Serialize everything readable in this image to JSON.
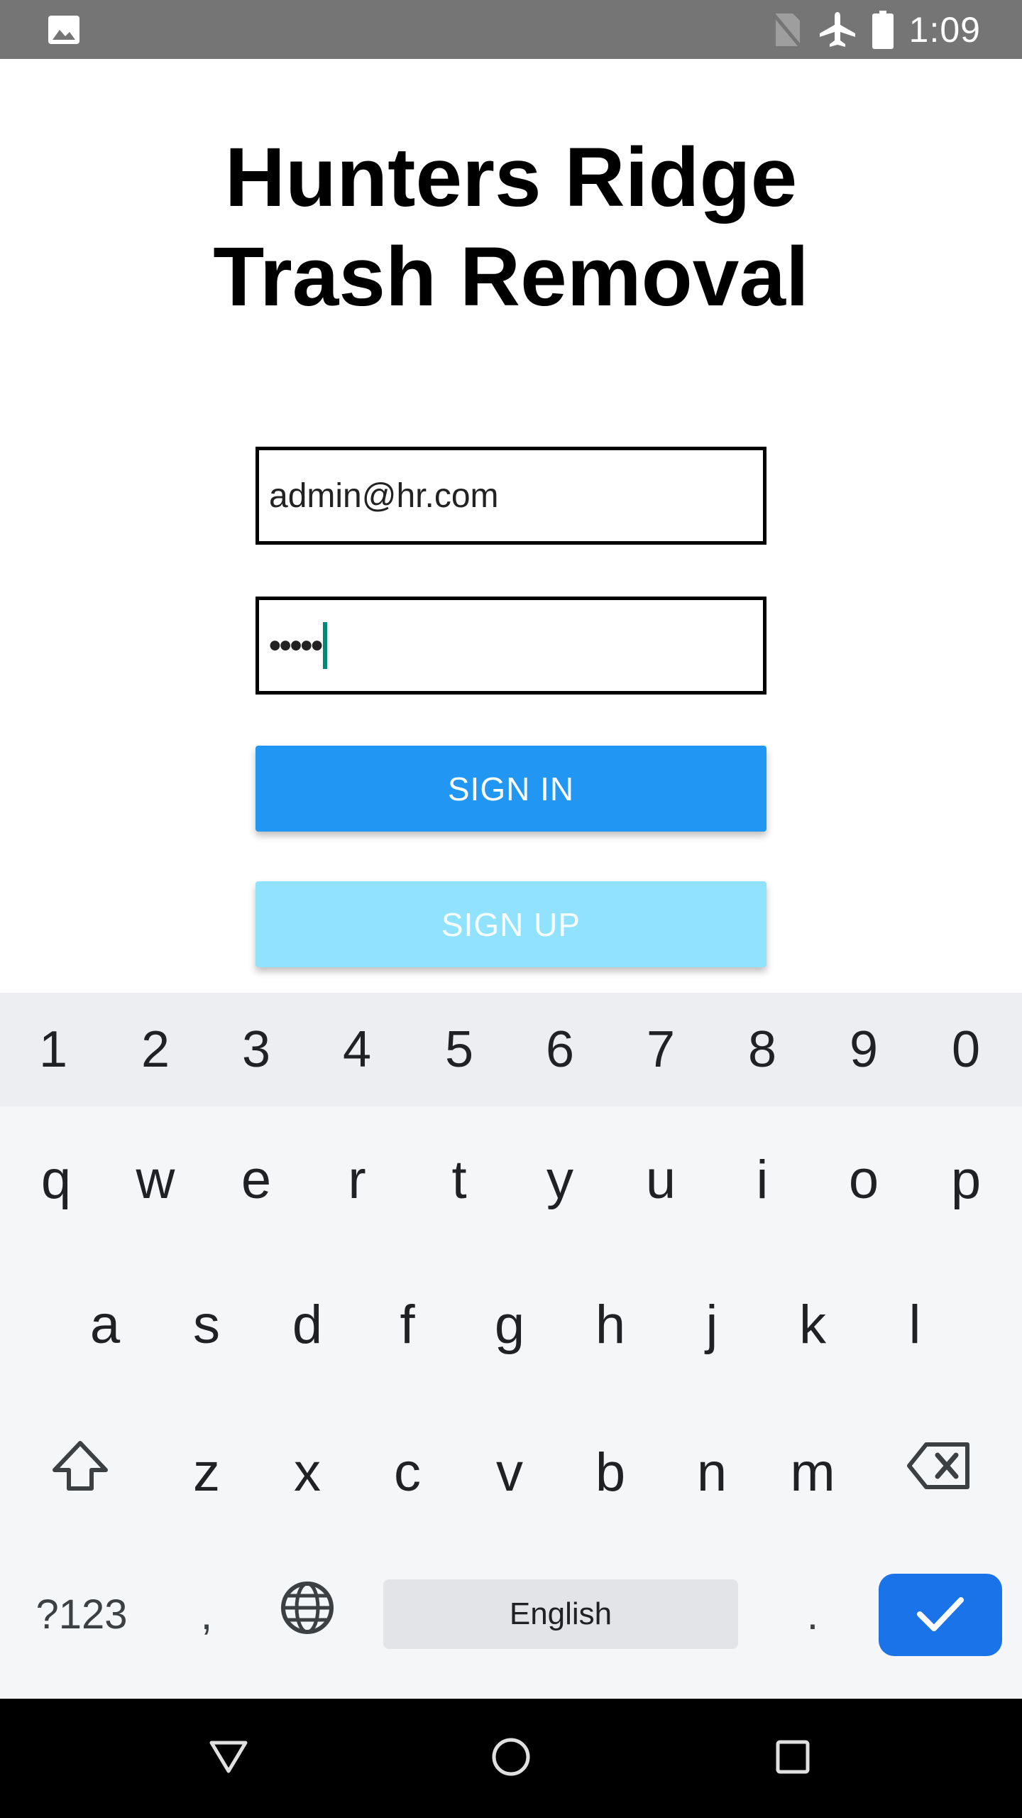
{
  "status_bar": {
    "time": "1:09",
    "icons": [
      "image-icon",
      "no-sim-icon",
      "airplane-mode-icon",
      "battery-icon"
    ]
  },
  "app": {
    "title_line1": "Hunters Ridge",
    "title_line2": "Trash Removal",
    "email_value": "admin@hr.com",
    "password_masked": "•••••",
    "signin_label": "SIGN IN",
    "signup_label": "SIGN UP",
    "colors": {
      "signin": "#2196f3",
      "signup": "#90e2ff",
      "caret": "#00897b"
    }
  },
  "keyboard": {
    "numbers": [
      "1",
      "2",
      "3",
      "4",
      "5",
      "6",
      "7",
      "8",
      "9",
      "0"
    ],
    "row1": [
      "q",
      "w",
      "e",
      "r",
      "t",
      "y",
      "u",
      "i",
      "o",
      "p"
    ],
    "row2": [
      "a",
      "s",
      "d",
      "f",
      "g",
      "h",
      "j",
      "k",
      "l"
    ],
    "row3": [
      "z",
      "x",
      "c",
      "v",
      "b",
      "n",
      "m"
    ],
    "symbols_label": "?123",
    "comma": ",",
    "space_label": "English",
    "period": ".",
    "enter_color": "#1a73e8",
    "icons": [
      "shift-icon",
      "backspace-icon",
      "globe-icon",
      "checkmark-icon"
    ]
  },
  "nav_bar": {
    "icons": [
      "back-triangle-icon",
      "home-circle-icon",
      "recents-square-icon"
    ]
  }
}
